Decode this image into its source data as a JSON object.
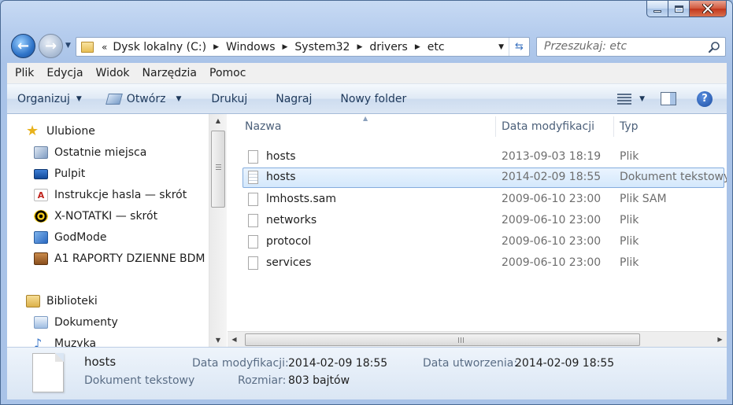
{
  "window": {
    "caption_buttons": [
      "minimize",
      "maximize",
      "close"
    ]
  },
  "address": {
    "lead": "«",
    "crumbs": [
      "Dysk lokalny (C:)",
      "Windows",
      "System32",
      "drivers",
      "etc"
    ]
  },
  "search": {
    "placeholder": "Przeszukaj: etc"
  },
  "menubar": {
    "items": [
      "Plik",
      "Edycja",
      "Widok",
      "Narzędzia",
      "Pomoc"
    ]
  },
  "toolbar": {
    "organize": "Organizuj",
    "open": "Otwórz",
    "print": "Drukuj",
    "burn": "Nagraj",
    "new_folder": "Nowy folder"
  },
  "nav": {
    "favorites_header": "Ulubione",
    "favorites": [
      {
        "label": "Ostatnie miejsca",
        "icon": "recent-places-icon"
      },
      {
        "label": "Pulpit",
        "icon": "desktop-icon"
      },
      {
        "label": "Instrukcje hasla — skrót",
        "icon": "pdf-shortcut-icon"
      },
      {
        "label": "X-NOTATKI — skrót",
        "icon": "radiation-shortcut-icon"
      },
      {
        "label": "GodMode",
        "icon": "control-panel-icon"
      },
      {
        "label": "A1 RAPORTY  DZIENNE BDM",
        "icon": "briefcase-icon"
      }
    ],
    "libraries_header": "Biblioteki",
    "libraries": [
      {
        "label": "Dokumenty",
        "icon": "documents-icon"
      },
      {
        "label": "Muzyka",
        "icon": "music-icon"
      }
    ]
  },
  "columns": {
    "name": "Nazwa",
    "date": "Data modyfikacji",
    "type": "Typ"
  },
  "files": [
    {
      "name": "hosts",
      "date": "2013-09-03 18:19",
      "type": "Plik",
      "selected": false
    },
    {
      "name": "hosts",
      "date": "2014-02-09 18:55",
      "type": "Dokument tekstowy",
      "selected": true
    },
    {
      "name": "lmhosts.sam",
      "date": "2009-06-10 23:00",
      "type": "Plik SAM",
      "selected": false
    },
    {
      "name": "networks",
      "date": "2009-06-10 23:00",
      "type": "Plik",
      "selected": false
    },
    {
      "name": "protocol",
      "date": "2009-06-10 23:00",
      "type": "Plik",
      "selected": false
    },
    {
      "name": "services",
      "date": "2009-06-10 23:00",
      "type": "Plik",
      "selected": false
    }
  ],
  "details": {
    "name": "hosts",
    "kind": "Dokument tekstowy",
    "modified_label": "Data modyfikacji:",
    "modified_value": "2014-02-09 18:55",
    "created_label": "Data utworzenia:",
    "created_value": "2014-02-09 18:55",
    "size_label": "Rozmiar:",
    "size_value": "803 bajtów"
  },
  "colors": {
    "selection_border": "#84acdd",
    "selection_fill": "#d4e8fc",
    "link_text": "#1e395b"
  }
}
